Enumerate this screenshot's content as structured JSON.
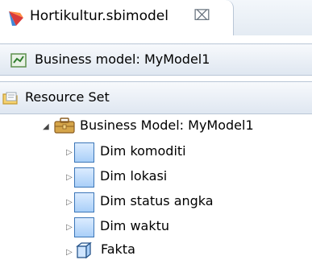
{
  "editor_tab": {
    "title": "Hortikultur.sbimodel",
    "icon": "sbi-model-icon",
    "close_symbol": "⌧"
  },
  "sections": [
    {
      "label": "Business model: MyModel1",
      "icon": "business-model-icon"
    },
    {
      "label": "Resource Set",
      "icon": "folder-icon"
    }
  ],
  "tree": {
    "root": {
      "label": "Business Model: MyModel1",
      "expanded": true
    },
    "items": [
      {
        "label": "Dim komoditi",
        "icon": "dimension-icon"
      },
      {
        "label": "Dim lokasi",
        "icon": "dimension-icon"
      },
      {
        "label": "Dim status angka",
        "icon": "dimension-icon"
      },
      {
        "label": "Dim waktu",
        "icon": "dimension-icon"
      },
      {
        "label": "Fakta",
        "icon": "fact-cube-icon"
      }
    ]
  },
  "colors": {
    "selection_blue": "#3b76b8",
    "section_border": "#b9c6d6"
  }
}
